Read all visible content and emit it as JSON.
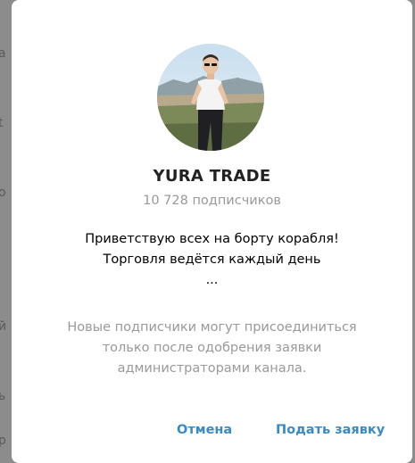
{
  "background": {
    "glyphs": [
      "a",
      "t",
      "о",
      "й",
      "ь",
      "р"
    ]
  },
  "channel": {
    "title": "YURA TRADE",
    "subscribers": "10 728 подписчиков",
    "description_lines": [
      "Приветствую всех на борту корабля!",
      "Торговля ведётся каждый день",
      "..."
    ]
  },
  "notice_lines": [
    "Новые подписчики могут присоединиться",
    "только после одобрения заявки",
    "администраторами канала."
  ],
  "buttons": {
    "cancel": "Отмена",
    "request": "Подать заявку"
  },
  "colors": {
    "accent": "#3a8ac4",
    "title": "#222222",
    "muted": "#999999",
    "overlay": "#8a8a8a"
  }
}
